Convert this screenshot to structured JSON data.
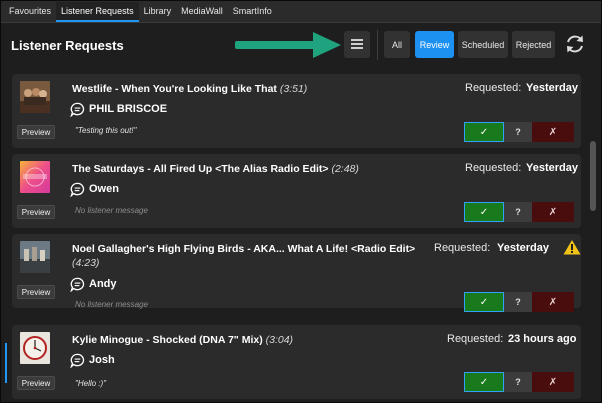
{
  "tabs": [
    {
      "label": "Favourites",
      "active": false
    },
    {
      "label": "Listener Requests",
      "active": true
    },
    {
      "label": "Library",
      "active": false
    },
    {
      "label": "MediaWall",
      "active": false
    },
    {
      "label": "SmartInfo",
      "active": false
    }
  ],
  "header": {
    "title": "Listener Requests",
    "filters": [
      {
        "label": "All",
        "active": false
      },
      {
        "label": "Review",
        "active": true
      },
      {
        "label": "Scheduled",
        "active": false
      },
      {
        "label": "Rejected",
        "active": false
      }
    ]
  },
  "colors": {
    "accent": "#1d91f2",
    "annotation_arrow": "#1fa37e",
    "approve": "#187a1c",
    "reject": "#4a0d0d",
    "warning": "#f2c21b"
  },
  "requests": [
    {
      "title": "Westlife - When You're Looking Like That",
      "duration": "(3:51)",
      "requested_label": "Requested:",
      "requested_value": "Yesterday",
      "user": "PHIL BRISCOE",
      "message": "\"Testing this out!\"",
      "preview_label": "Preview",
      "approve": "✓",
      "maybe": "?",
      "reject": "✗"
    },
    {
      "title": "The Saturdays - All Fired Up <The Alias Radio Edit>",
      "duration": "(2:48)",
      "requested_label": "Requested:",
      "requested_value": "Yesterday",
      "user": "Owen",
      "message": "No listener message",
      "preview_label": "Preview",
      "approve": "✓",
      "maybe": "?",
      "reject": "✗"
    },
    {
      "title": "Noel Gallagher's High Flying Birds - AKA... What A Life! <Radio Edit>",
      "duration": "(4:23)",
      "requested_label": "Requested:",
      "requested_value": "Yesterday",
      "user": "Andy",
      "message": "No listener message",
      "preview_label": "Preview",
      "warning_icon": "warning-icon",
      "approve": "✓",
      "maybe": "?",
      "reject": "✗"
    },
    {
      "title": "Kylie Minogue - Shocked (DNA 7\" Mix)",
      "duration": "(3:04)",
      "requested_label": "Requested:",
      "requested_value": "23 hours ago",
      "user": "Josh",
      "message": "\"Hello :)\"",
      "preview_label": "Preview",
      "approve": "✓",
      "maybe": "?",
      "reject": "✗"
    }
  ]
}
